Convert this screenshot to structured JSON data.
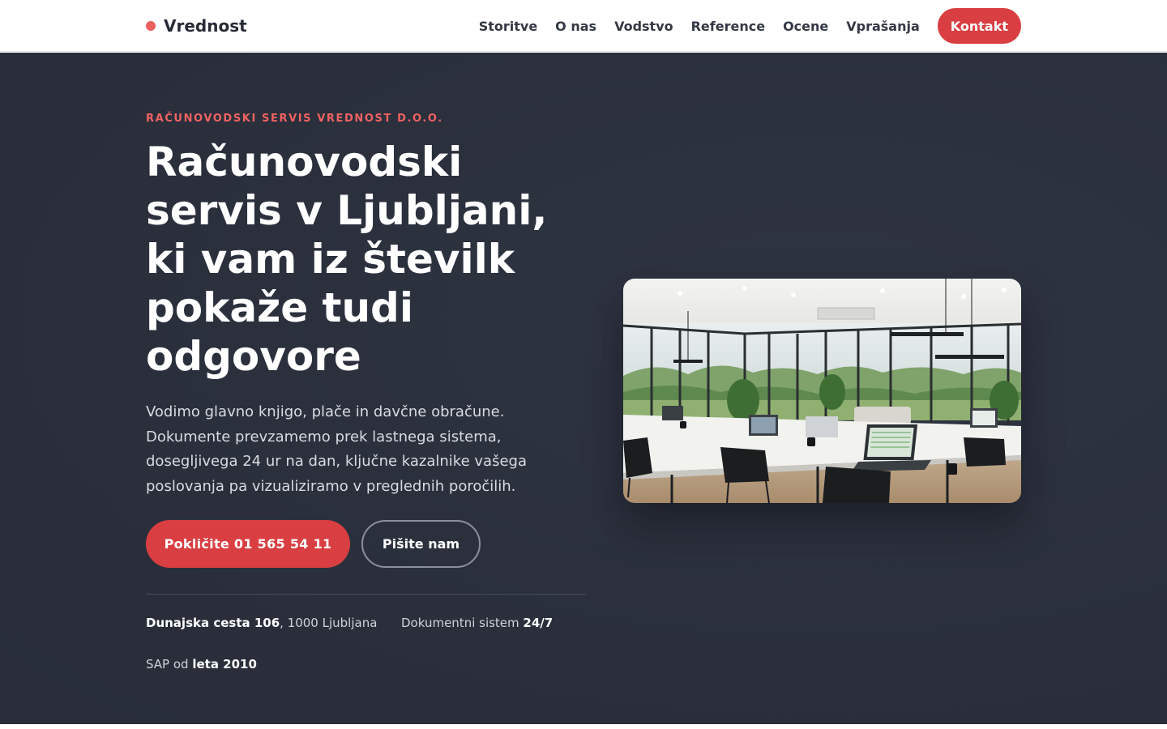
{
  "header": {
    "brand": "Vrednost",
    "nav": [
      "Storitve",
      "O nas",
      "Vodstvo",
      "Reference",
      "Ocene",
      "Vprašanja"
    ],
    "cta": "Kontakt"
  },
  "hero": {
    "eyebrow": "RAČUNOVODSKI SERVIS VREDNOST D.O.O.",
    "title": "Računovodski servis v Ljubljani, ki vam iz številk pokaže tudi odgovore",
    "lead": "Vodimo glavno knjigo, plače in davčne obračune. Dokumente prevzamemo prek lastnega sistema, dosegljivega 24 ur na dan, ključne kazalnike vašega poslovanja pa vizualiziramo v preglednih poročilih.",
    "primary_cta": "Pokličite 01 565 54 11",
    "secondary_cta": "Pišite nam",
    "facts": {
      "address_bold": "Dunajska cesta 106",
      "address_rest": ", 1000 Ljubljana",
      "docs_label": "Dokumentni sistem ",
      "docs_bold": "24/7",
      "sap_label": "SAP od ",
      "sap_bold": "leta 2010"
    }
  },
  "colors": {
    "accent": "#d93f42",
    "eyebrow": "#f06262",
    "hero_bg": "#2a2f3b"
  }
}
